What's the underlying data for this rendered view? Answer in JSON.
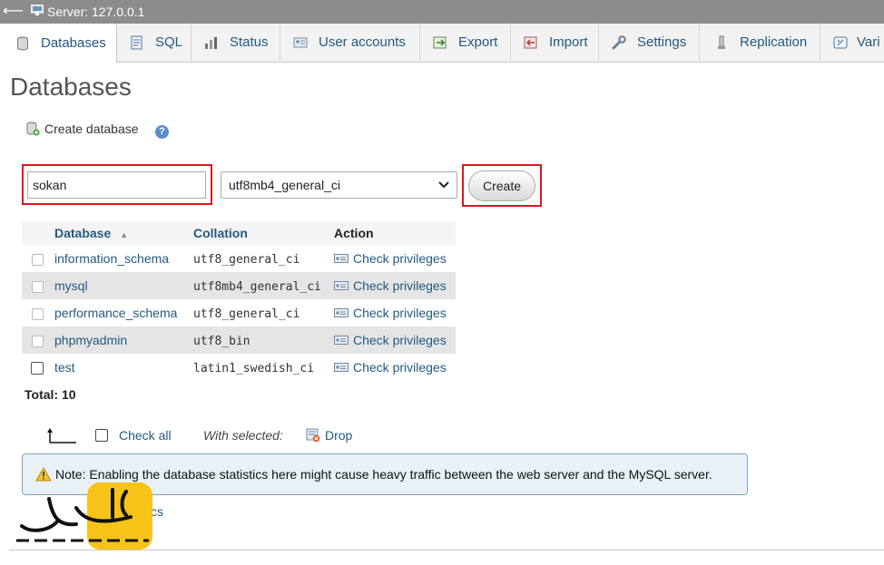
{
  "topbar": {
    "server_label": "Server: 127.0.0.1"
  },
  "tabs": [
    {
      "label": "Databases",
      "icon": "database-icon"
    },
    {
      "label": "SQL",
      "icon": "sql-icon"
    },
    {
      "label": "Status",
      "icon": "status-icon"
    },
    {
      "label": "User accounts",
      "icon": "user-accounts-icon"
    },
    {
      "label": "Export",
      "icon": "export-icon"
    },
    {
      "label": "Import",
      "icon": "import-icon"
    },
    {
      "label": "Settings",
      "icon": "wrench-icon"
    },
    {
      "label": "Replication",
      "icon": "replication-icon"
    },
    {
      "label": "Vari",
      "icon": "variables-icon"
    }
  ],
  "page_title": "Databases",
  "create_section": {
    "label": "Create database",
    "name_value": "sokan",
    "collation_value": "utf8mb4_general_ci",
    "create_button": "Create"
  },
  "table": {
    "headers": {
      "database": "Database",
      "collation": "Collation",
      "action": "Action"
    },
    "rows": [
      {
        "name": "information_schema",
        "collation": "utf8_general_ci",
        "action": "Check privileges"
      },
      {
        "name": "mysql",
        "collation": "utf8mb4_general_ci",
        "action": "Check privileges"
      },
      {
        "name": "performance_schema",
        "collation": "utf8_general_ci",
        "action": "Check privileges"
      },
      {
        "name": "phpmyadmin",
        "collation": "utf8_bin",
        "action": "Check privileges"
      },
      {
        "name": "test",
        "collation": "latin1_swedish_ci",
        "action": "Check privileges"
      }
    ],
    "total": "Total: 10"
  },
  "bulk": {
    "check_all": "Check all",
    "with_selected": "With selected:",
    "drop": "Drop"
  },
  "note": "Note: Enabling the database statistics here might cause heavy traffic between the web server and the MySQL server.",
  "enable_statistics": "cs",
  "colors": {
    "link": "#235a81",
    "highlight": "#e0141e",
    "note_bg": "#e8f1f5",
    "logo_yellow": "#f7c318"
  }
}
